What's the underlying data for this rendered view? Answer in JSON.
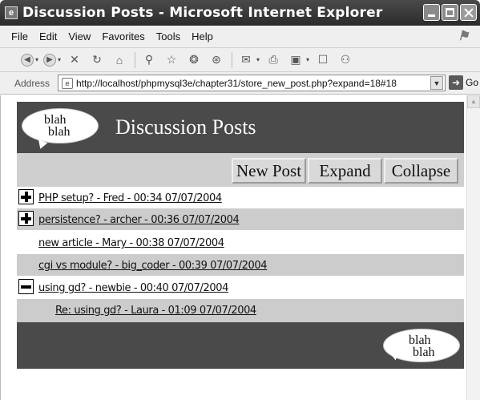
{
  "window": {
    "title": "Discussion Posts - Microsoft Internet Explorer",
    "app_icon": "ie-page-icon"
  },
  "menu": [
    "File",
    "Edit",
    "View",
    "Favorites",
    "Tools",
    "Help"
  ],
  "address": {
    "label": "Address",
    "url": "http://localhost/phpmysql3e/chapter31/store_new_post.php?expand=18#18",
    "go_label": "Go"
  },
  "page": {
    "logo_text_line1": "blah",
    "logo_text_line2": "blah",
    "title": "Discussion Posts",
    "buttons": [
      "New Post",
      "Expand",
      "Collapse"
    ],
    "posts": [
      {
        "text": "PHP setup? - Fred - 00:34 07/07/2004",
        "toggle": "plus",
        "indent": 0
      },
      {
        "text": "persistence? - archer - 00:36 07/07/2004",
        "toggle": "plus",
        "indent": 0
      },
      {
        "text": "new article - Mary - 00:38 07/07/2004",
        "toggle": "none",
        "indent": 0
      },
      {
        "text": "cgi vs module? - big_coder - 00:39 07/07/2004",
        "toggle": "none",
        "indent": 0
      },
      {
        "text": "using gd? - newbie - 00:40 07/07/2004",
        "toggle": "minus",
        "indent": 0
      },
      {
        "text": "Re: using gd? - Laura - 01:09 07/07/2004",
        "toggle": "none",
        "indent": 1
      }
    ]
  }
}
